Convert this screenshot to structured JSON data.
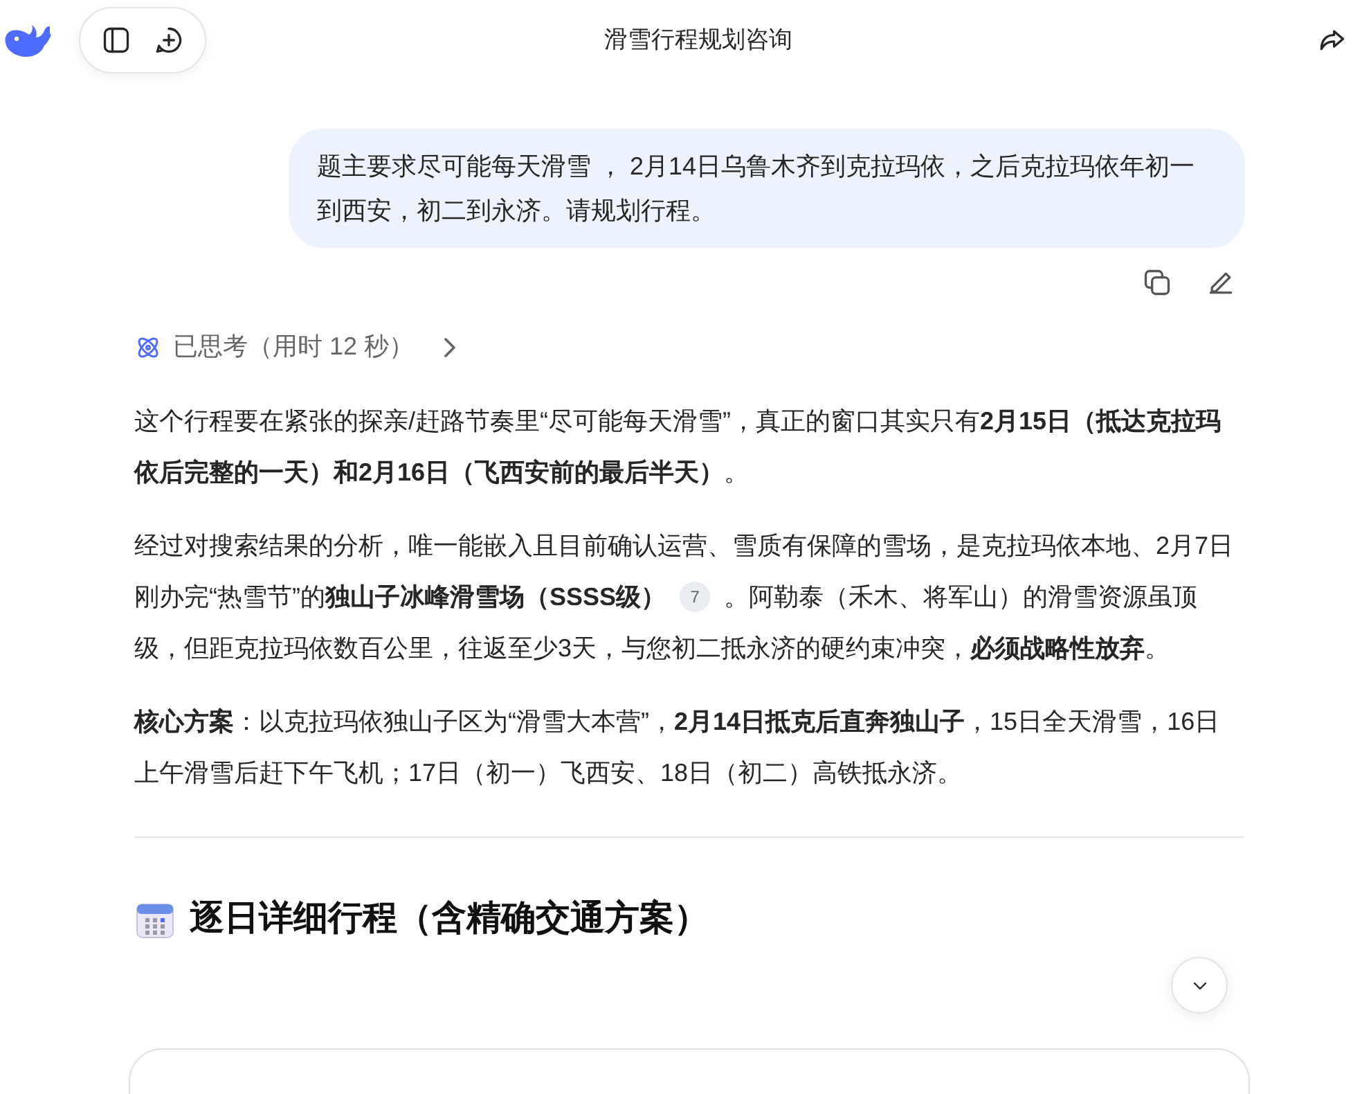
{
  "header": {
    "title": "滑雪行程规划咨询"
  },
  "user_message": {
    "text": "题主要求尽可能每天滑雪 ， 2月14日乌鲁木齐到克拉玛依，之后克拉玛依年初一到西安，初二到永济。请规划行程。"
  },
  "thinking": {
    "label": "已思考（用时 12 秒）",
    "expanded": false
  },
  "paragraphs": [
    [
      {
        "kind": "text",
        "text": "这个行程要在紧张的探亲/赶路节奏里“尽可能每天滑雪”，真正的窗口其实只有**2月15日（抵达克拉玛依后完整的一天）和2月16日（飞西安前的最后半天）**。"
      }
    ],
    [
      {
        "kind": "text",
        "text": "经过对搜索结果的分析，唯一能嵌入且目前确认运营、雪质有保障的雪场，是克拉玛依本地、2月7日刚办完“热雪节”的**独山子冰峰滑雪场（SSSS级）**"
      },
      {
        "kind": "citation",
        "text": "7"
      },
      {
        "kind": "text",
        "text": "。阿勒泰（禾木、将军山）的滑雪资源虽顶级，但距克拉玛依数百公里，往返至少3天，与您初二抵永济的硬约束冲突，**必须战略性放弃**。"
      }
    ],
    [
      {
        "kind": "text",
        "text": "**核心方案**：以克拉玛依独山子区为“滑雪大本营”，**2月14日抵克后直奔独山子**，15日全天滑雪，16日上午滑雪后赶下午飞机；17日（初一）飞西安、18日（初二）高铁抵永济。"
      }
    ]
  ],
  "section_heading": "逐日详细行程（含精确交通方案）"
}
